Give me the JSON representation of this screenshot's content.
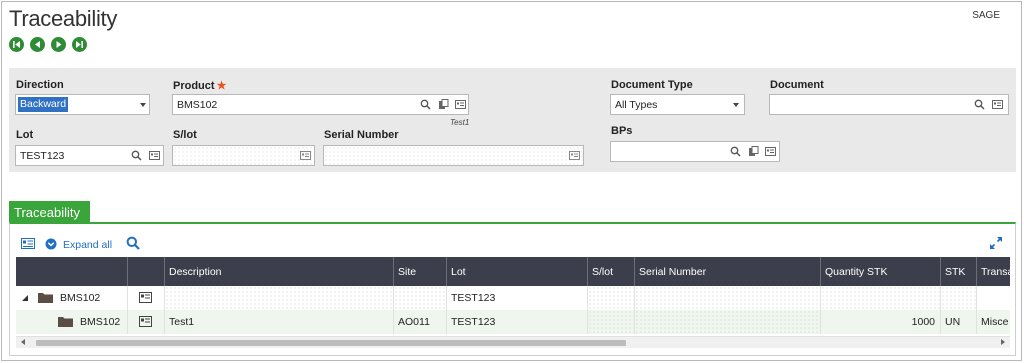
{
  "page": {
    "title": "Traceability",
    "brand": "SAGE"
  },
  "nav": {
    "buttons": [
      "first-record-icon",
      "previous-record-icon",
      "next-record-icon",
      "last-record-icon"
    ]
  },
  "criteria": {
    "direction": {
      "label": "Direction",
      "value": "Backward"
    },
    "product": {
      "label": "Product",
      "required_mark": "★",
      "value": "BMS102",
      "description": "Test1"
    },
    "document_type": {
      "label": "Document Type",
      "value": "All Types"
    },
    "document": {
      "label": "Document",
      "value": ""
    },
    "lot": {
      "label": "Lot",
      "value": "TEST123"
    },
    "slot": {
      "label": "S/lot",
      "value": ""
    },
    "serial": {
      "label": "Serial Number",
      "value": ""
    },
    "bps": {
      "label": "BPs",
      "value": ""
    }
  },
  "section": {
    "tab_label": "Traceability",
    "expand_all": "Expand all",
    "columns": [
      "Description",
      "Site",
      "Lot",
      "S/lot",
      "Serial Number",
      "Quantity STK",
      "STK",
      "Transaction"
    ],
    "rows": [
      {
        "tree_label": "BMS102",
        "description": "",
        "site": "",
        "lot": "TEST123",
        "slot": "",
        "serial": "",
        "qty": "",
        "stk": "",
        "transaction": ""
      },
      {
        "tree_label": "BMS102",
        "description": "Test1",
        "site": "AO011",
        "lot": "TEST123",
        "slot": "",
        "serial": "",
        "qty": "1000",
        "stk": "UN",
        "transaction": "Misce"
      }
    ]
  },
  "colors": {
    "accent_green": "#3aa53a",
    "nav_green": "#2e8b36",
    "header_dark": "#3c3f4b",
    "link_blue": "#1f6fc6",
    "required": "#e8541b"
  }
}
